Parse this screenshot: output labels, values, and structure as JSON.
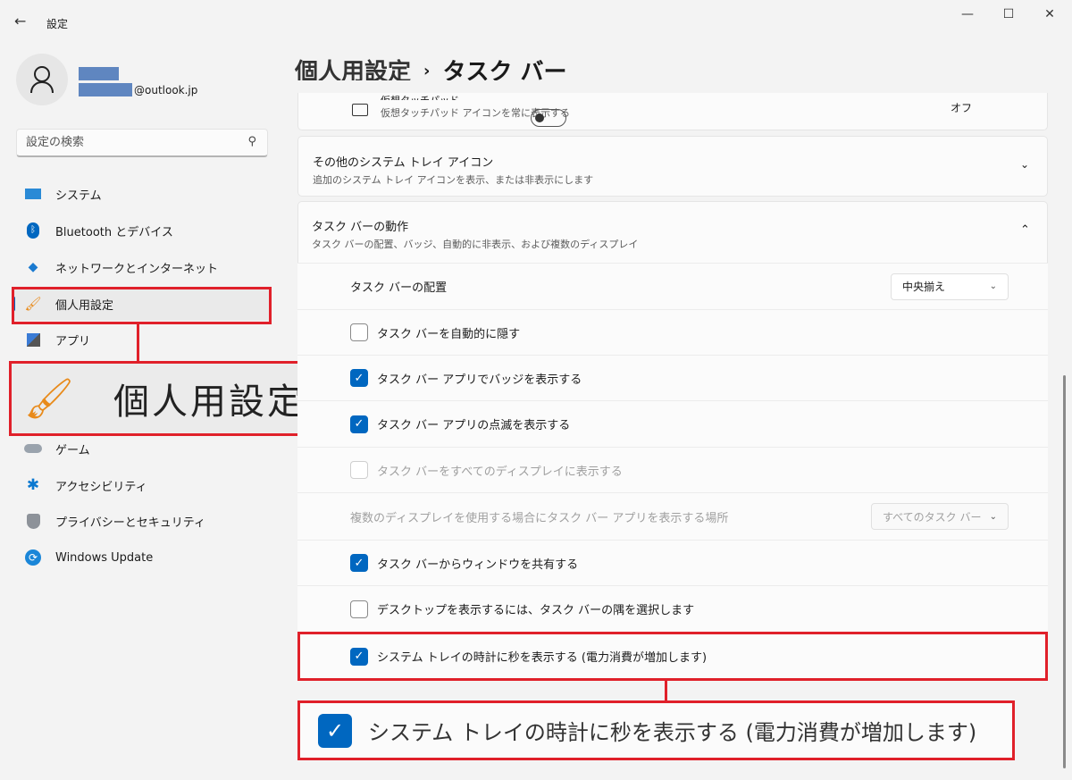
{
  "window": {
    "title": "設定",
    "back_icon": "arrow-left-icon",
    "controls": [
      "minimize",
      "maximize",
      "close"
    ]
  },
  "account": {
    "email_suffix": "@outlook.jp"
  },
  "search": {
    "placeholder": "設定の検索"
  },
  "sidebar": {
    "items": [
      {
        "label": "システム",
        "icon": "monitor-icon"
      },
      {
        "label": "Bluetooth とデバイス",
        "icon": "bluetooth-icon"
      },
      {
        "label": "ネットワークとインターネット",
        "icon": "wifi-icon"
      },
      {
        "label": "個人用設定",
        "icon": "paintbrush-icon",
        "selected": true
      },
      {
        "label": "アプリ",
        "icon": "apps-icon"
      },
      {
        "label": "ゲーム",
        "icon": "gamepad-icon"
      },
      {
        "label": "アクセシビリティ",
        "icon": "accessibility-icon"
      },
      {
        "label": "プライバシーとセキュリティ",
        "icon": "shield-icon"
      },
      {
        "label": "Windows Update",
        "icon": "update-icon"
      }
    ]
  },
  "breadcrumb": {
    "parent": "個人用設定",
    "current": "タスク バー"
  },
  "touchpad": {
    "title": "仮想タッチパッド",
    "subtitle": "仮想タッチパッド アイコンを常に表示する",
    "state_label": "オフ",
    "on": false
  },
  "tray_icons": {
    "title": "その他のシステム トレイ アイコン",
    "subtitle": "追加のシステム トレイ アイコンを表示、または非表示にします"
  },
  "behaviors": {
    "title": "タスク バーの動作",
    "subtitle": "タスク バーの配置、バッジ、自動的に非表示、および複数のディスプレイ",
    "alignment": {
      "label": "タスク バーの配置",
      "value": "中央揃え"
    },
    "auto_hide": {
      "label": "タスク バーを自動的に隠す",
      "checked": false
    },
    "badges": {
      "label": "タスク バー アプリでバッジを表示する",
      "checked": true
    },
    "flashing": {
      "label": "タスク バー アプリの点滅を表示する",
      "checked": true
    },
    "all_displays": {
      "label": "タスク バーをすべてのディスプレイに表示する",
      "checked": false,
      "disabled": true
    },
    "multi_display": {
      "label": "複数のディスプレイを使用する場合にタスク バー アプリを表示する場所",
      "value": "すべてのタスク バー",
      "disabled": true
    },
    "share_window": {
      "label": "タスク バーからウィンドウを共有する",
      "checked": true
    },
    "corner": {
      "label": "デスクトップを表示するには、タスク バーの隅を選択します",
      "checked": false
    },
    "seconds": {
      "label": "システム トレイの時計に秒を表示する (電力消費が増加します)",
      "checked": true
    }
  },
  "callouts": {
    "sidebar_zoom": "個人用設定",
    "seconds_zoom": "システム トレイの時計に秒を表示する (電力消費が増加します)"
  },
  "colors": {
    "accent": "#0067c0",
    "highlight": "#e0202a"
  }
}
